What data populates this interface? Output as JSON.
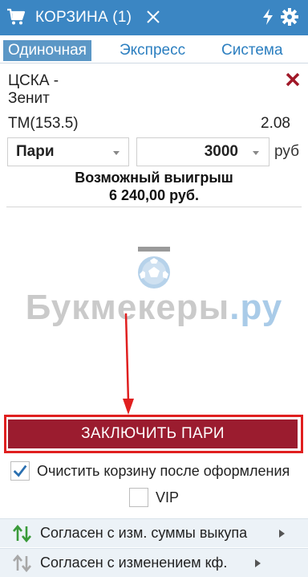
{
  "header": {
    "title": "КОРЗИНА (1)",
    "background": "#3b86c3",
    "icons": [
      "cart-icon",
      "close-icon",
      "bolt-icon",
      "gear-icon"
    ]
  },
  "tabs": [
    {
      "label": "Одиночная",
      "active": true
    },
    {
      "label": "Экспресс",
      "active": false
    },
    {
      "label": "Система",
      "active": false
    }
  ],
  "bet": {
    "match_line1": "ЦСКА -",
    "match_line2": "Зенит",
    "market": "ТМ(153.5)",
    "odds": "2.08",
    "bet_type": "Пари",
    "amount": "3000",
    "currency": "руб"
  },
  "winnings": {
    "label": "Возможный выигрыш",
    "value": "6 240,00 руб."
  },
  "watermark": {
    "main": "Букмекеры",
    "suffix": ".ру",
    "color_main": "#cacaca",
    "color_suffix": "#a9cbe8"
  },
  "confirm": {
    "label": "ЗАКЛЮЧИТЬ ПАРИ",
    "color": "#9b1c2f",
    "highlight_color": "#e01f1f"
  },
  "options": {
    "clear_cart_label": "Очистить корзину после оформления",
    "clear_cart_checked": true,
    "vip_label": "VIP",
    "vip_checked": false
  },
  "agree": [
    {
      "label": "Согласен с изм. суммы выкупа",
      "icon": "arrows-updown-icon",
      "active": true
    },
    {
      "label": "Согласен с изменением кф.",
      "icon": "arrows-updown-icon",
      "active": false
    }
  ]
}
